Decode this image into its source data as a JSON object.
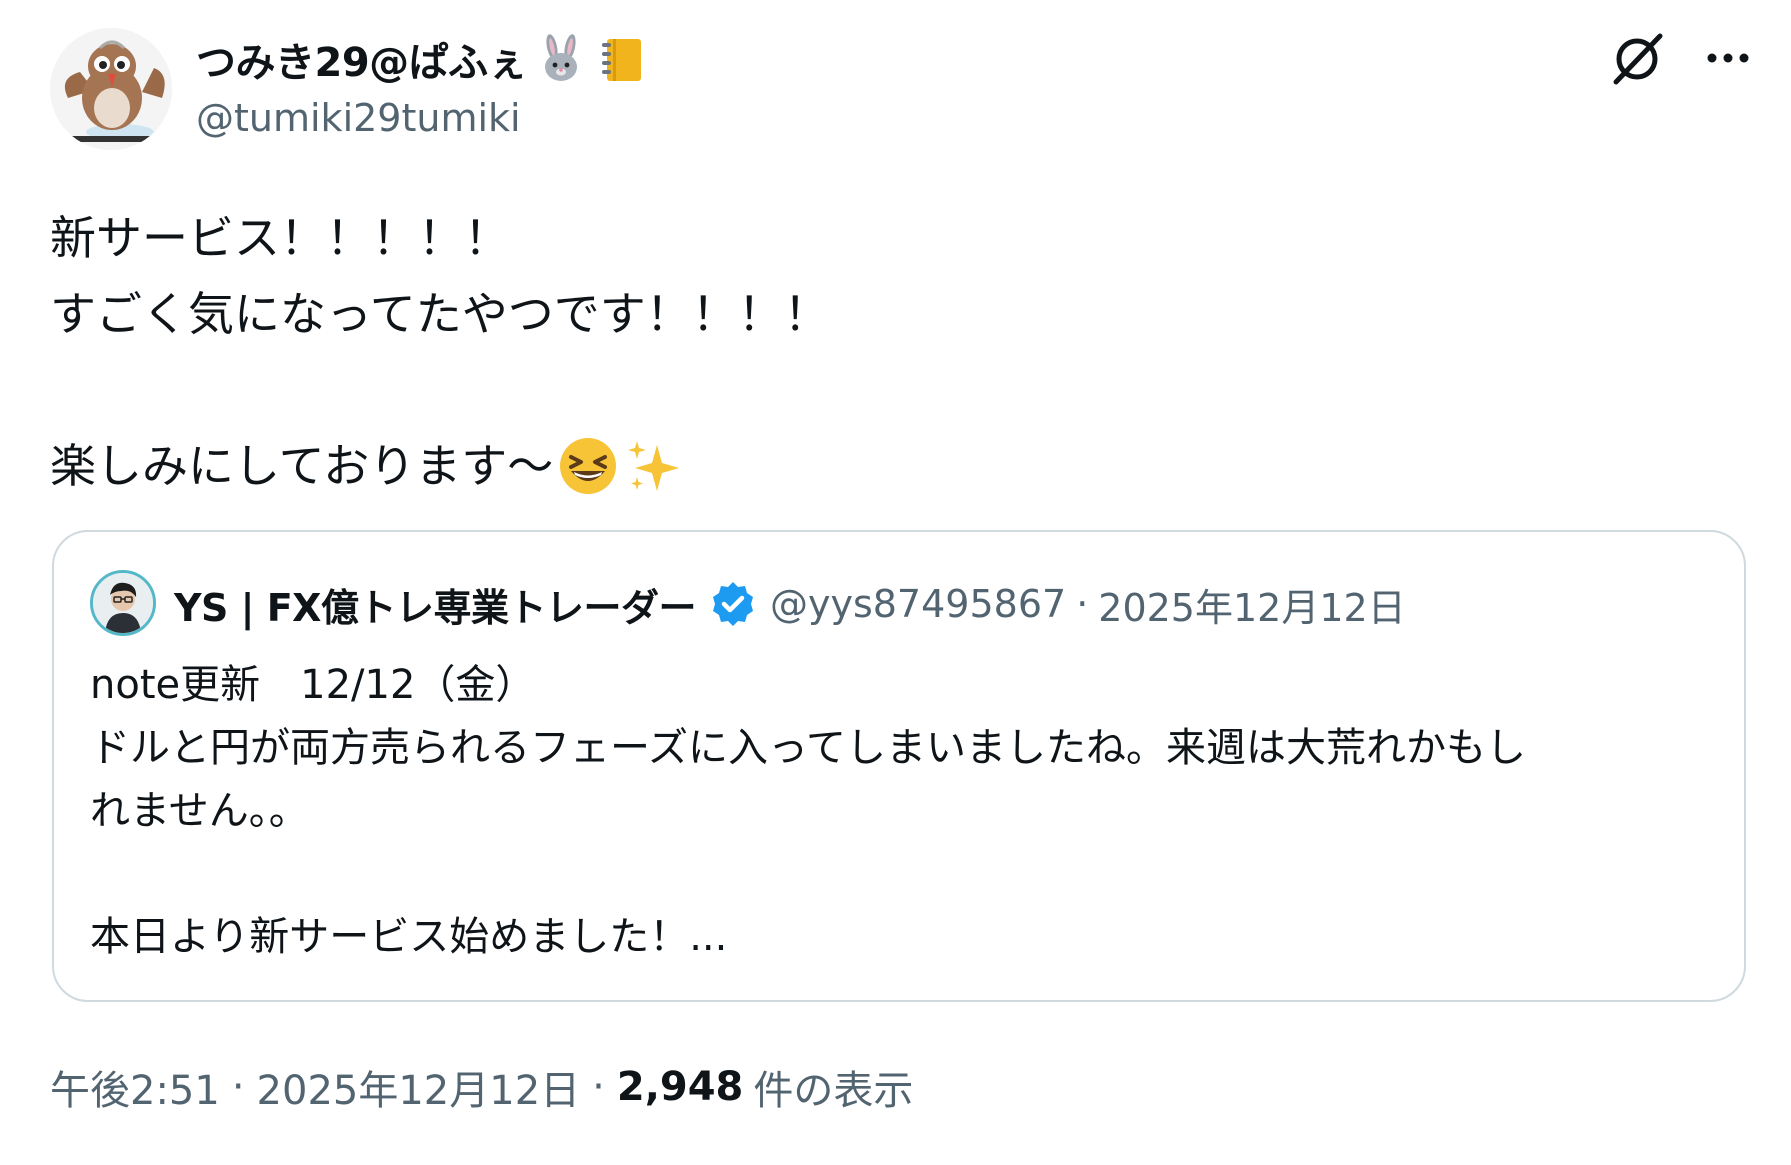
{
  "tweet": {
    "author": {
      "display_name": "つみき29@ぱふぇ",
      "handle": "@tumiki29tumiki",
      "name_emojis": [
        "rabbit-face-emoji",
        "notebook-emoji"
      ]
    },
    "icons": {
      "grok": "grok-icon",
      "more": "more-options-icon"
    },
    "text_lines": [
      "新サービス！！！！！",
      "すごく気になってたやつです！！！！",
      "",
      "楽しみにしております〜"
    ],
    "text_emojis": [
      "grinning-squinting-face-emoji",
      "sparkles-emoji"
    ],
    "quote": {
      "display_name": "YS | FX億トレ専業トレーダー",
      "verified": true,
      "handle": "@yys87495867",
      "separator": "·",
      "date": "2025年12月12日",
      "text_lines": [
        "note更新　12/12（金）",
        "ドルと円が両方売られるフェーズに入ってしまいましたね。来週は大荒れかもし",
        "れません。。",
        "",
        "本日より新サービス始めました！..."
      ]
    },
    "meta": {
      "time": "午後2:51",
      "separator": "·",
      "date": "2025年12月12日",
      "views_count": "2,948",
      "views_label": "件の表示"
    }
  },
  "colors": {
    "text_primary": "#0f1419",
    "text_secondary": "#536471",
    "border": "#cfd9de",
    "verified_blue": "#1d9bf0"
  }
}
